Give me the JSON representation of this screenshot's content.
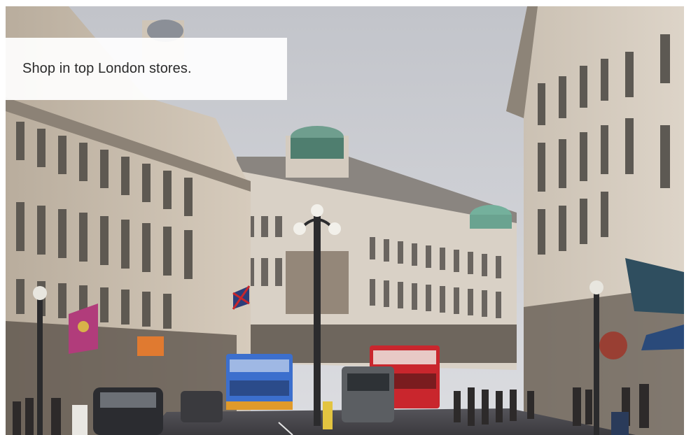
{
  "caption": {
    "text": "Shop in top London stores."
  },
  "photo": {
    "sky": "#cfd0d5",
    "stone": "#d8cfc2",
    "stone_shadow": "#a99f92",
    "dome": "#6fa694",
    "road": "#4b4a4d",
    "flag_magenta": "#b23a7a",
    "flag_teal": "#2e4d5f",
    "bus_blue": "#3b6fcf",
    "bus_red": "#c8262c"
  }
}
